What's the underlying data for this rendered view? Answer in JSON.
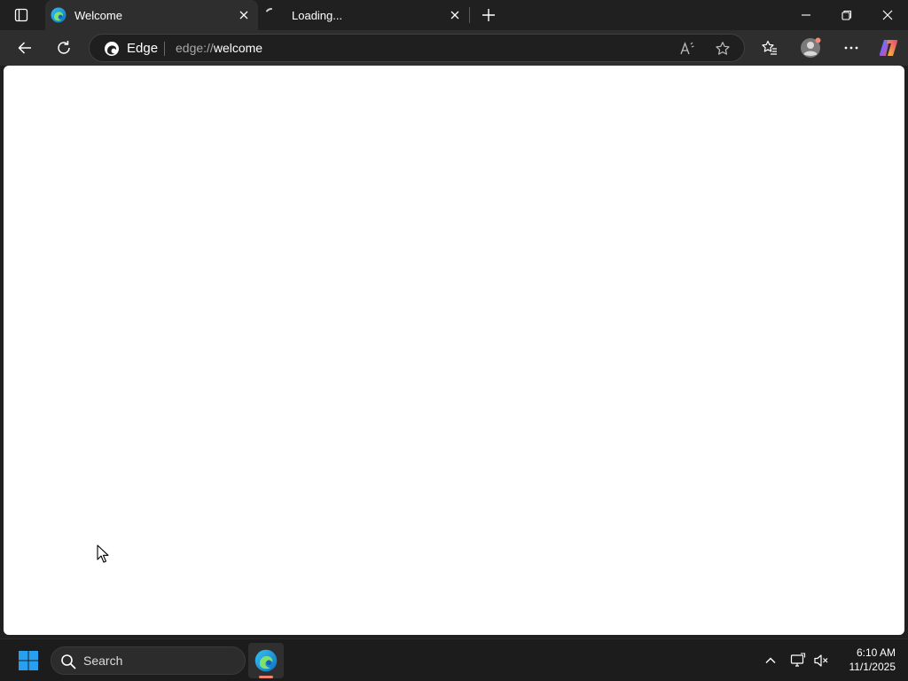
{
  "window": {
    "tabs": [
      {
        "title": "Welcome",
        "favicon": "edge-icon",
        "active": true
      },
      {
        "title": "Loading...",
        "favicon": "loading-spinner-icon",
        "active": false
      }
    ],
    "controls": [
      "minimize-icon",
      "restore-icon",
      "close-icon"
    ]
  },
  "toolbar": {
    "back_icon": "back-arrow-icon",
    "refresh_icon": "refresh-icon",
    "omnibox": {
      "chip_label": "Edge",
      "url_scheme": "edge://",
      "url_rest": "welcome"
    },
    "right_icons": [
      "read-aloud-icon",
      "favorite-star-icon",
      "favorites-icon",
      "profile-icon",
      "more-icon",
      "copilot-icon"
    ]
  },
  "taskbar": {
    "search_label": "Search",
    "apps": [
      "edge-icon"
    ],
    "tray_icons": [
      "chevron-up-icon",
      "network-icon",
      "volume-muted-icon"
    ],
    "clock": {
      "time": "6:10 AM",
      "date": "11/1/2025"
    }
  },
  "colors": {
    "frame": "#202020",
    "toolbar": "#2e2e2e",
    "content": "#ffffff",
    "taskbar": "#1c1c1c",
    "windows_blue": "#28a0f0",
    "app_indicator": "#f0826e"
  }
}
